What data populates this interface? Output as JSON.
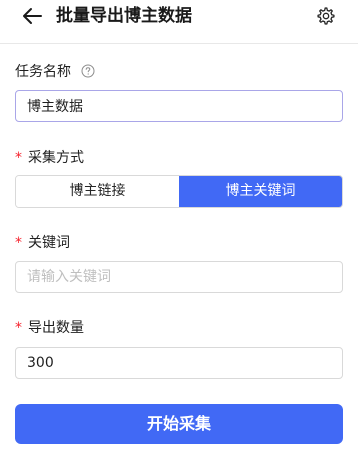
{
  "header": {
    "title": "批量导出博主数据"
  },
  "form": {
    "task_name": {
      "label": "任务名称",
      "value": "博主数据"
    },
    "collect_method": {
      "required_mark": "*",
      "label": "采集方式",
      "options": [
        "博主链接",
        "博主关键词"
      ],
      "selected": "博主关键词"
    },
    "keyword": {
      "required_mark": "*",
      "label": "关键词",
      "value": "",
      "placeholder": "请输入关键词"
    },
    "export_count": {
      "required_mark": "*",
      "label": "导出数量",
      "value": "300"
    }
  },
  "submit_label": "开始采集",
  "colors": {
    "primary": "#4169f5",
    "required": "#f5222d"
  },
  "icons": {
    "back": "arrow-left-icon",
    "settings": "gear-icon",
    "help": "question-circle-icon"
  }
}
